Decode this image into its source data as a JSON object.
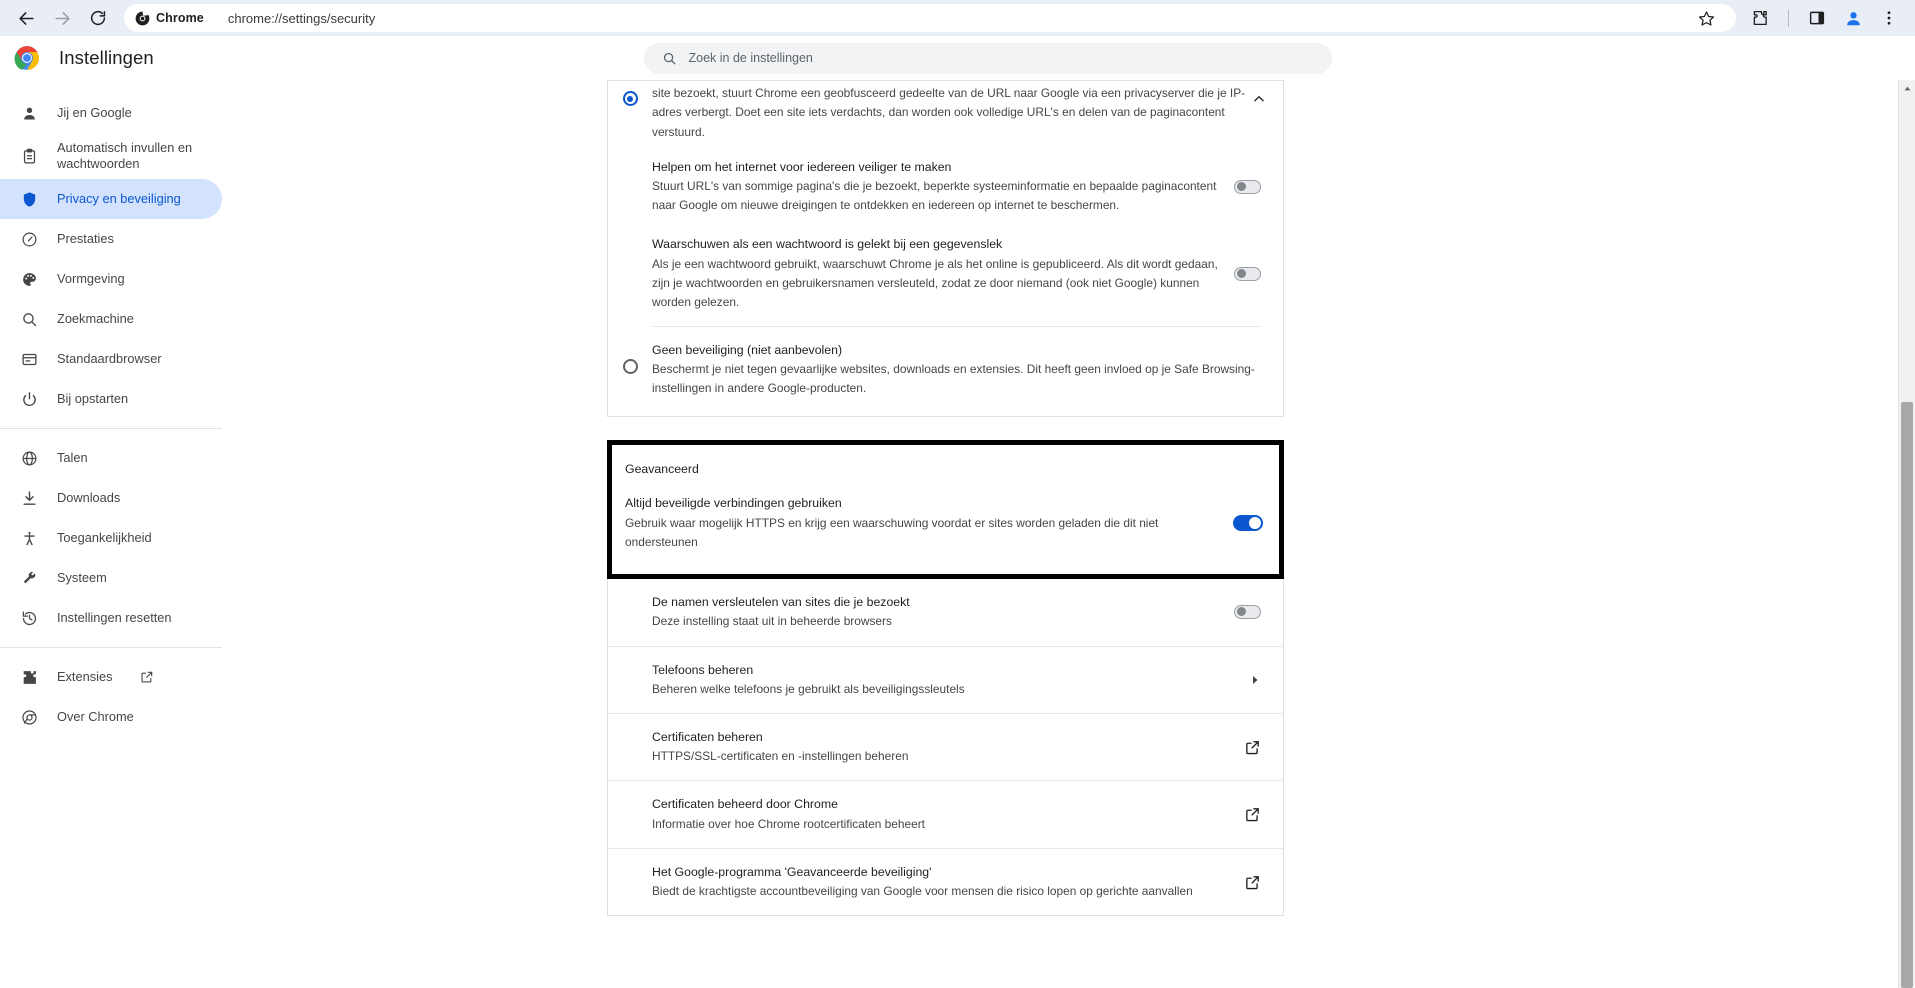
{
  "browser": {
    "back_label": "back-arrow",
    "forward_label": "forward-arrow",
    "reload_label": "reload",
    "chrome_chip_label": "Chrome",
    "url": "chrome://settings/security",
    "bookmark_label": "bookmark-star",
    "extensions_label": "extensions-puzzle",
    "sidepanel_label": "side-panel",
    "profile_label": "profile-avatar",
    "menu_label": "three-dot-menu"
  },
  "header": {
    "title": "Instellingen",
    "logo": "chrome-logo"
  },
  "search": {
    "placeholder": "Zoek in de instellingen",
    "icon": "search-icon"
  },
  "sidebar": {
    "items": [
      {
        "label": "Jij en Google",
        "icon": "person-icon",
        "active": false
      },
      {
        "label": "Automatisch invullen en wachtwoorden",
        "icon": "clipboard-icon",
        "active": false
      },
      {
        "label": "Privacy en beveiliging",
        "icon": "shield-icon",
        "active": true
      },
      {
        "label": "Prestaties",
        "icon": "speedometer-icon",
        "active": false
      },
      {
        "label": "Vormgeving",
        "icon": "palette-icon",
        "active": false
      },
      {
        "label": "Zoekmachine",
        "icon": "search-icon",
        "active": false
      },
      {
        "label": "Standaardbrowser",
        "icon": "browser-window-icon",
        "active": false
      },
      {
        "label": "Bij opstarten",
        "icon": "power-icon",
        "active": false
      }
    ],
    "items2": [
      {
        "label": "Talen",
        "icon": "globe-icon"
      },
      {
        "label": "Downloads",
        "icon": "download-icon"
      },
      {
        "label": "Toegankelijkheid",
        "icon": "accessibility-icon"
      },
      {
        "label": "Systeem",
        "icon": "wrench-icon"
      },
      {
        "label": "Instellingen resetten",
        "icon": "history-restore-icon"
      }
    ],
    "items3": [
      {
        "label": "Extensies",
        "icon": "puzzle-icon",
        "external": true
      },
      {
        "label": "Over Chrome",
        "icon": "chrome-icon",
        "external": false
      }
    ]
  },
  "main": {
    "enhanced_protection": {
      "description": "site bezoekt, stuurt Chrome een geobfusceerd gedeelte van de URL naar Google via een privacyserver die je IP-adres verbergt. Doet een site iets verdachts, dan worden ook volledige URL's en delen van de paginacontent verstuurd.",
      "selected": true
    },
    "sub_settings": [
      {
        "title": "Helpen om het internet voor iedereen veiliger te maken",
        "sub": "Stuurt URL's van sommige pagina's die je bezoekt, beperkte systeeminformatie en bepaalde paginacontent naar Google om nieuwe dreigingen te ontdekken en iedereen op internet te beschermen.",
        "toggle_on": false
      },
      {
        "title": "Waarschuwen als een wachtwoord is gelekt bij een gegevenslek",
        "sub": "Als je een wachtwoord gebruikt, waarschuwt Chrome je als het online is gepubliceerd. Als dit wordt gedaan, zijn je wachtwoorden en gebruikersnamen versleuteld, zodat ze door niemand (ook niet Google) kunnen worden gelezen.",
        "toggle_on": false
      }
    ],
    "no_protection": {
      "title": "Geen beveiliging (niet aanbevolen)",
      "sub": "Beschermt je niet tegen gevaarlijke websites, downloads en extensies. Dit heeft geen invloed op je Safe Browsing-instellingen in andere Google-producten.",
      "selected": false
    },
    "advanced": {
      "section_label": "Geavanceerd",
      "https_title": "Altijd beveiligde verbindingen gebruiken",
      "https_sub": "Gebruik waar mogelijk HTTPS en krijg een waarschuwing voordat er sites worden geladen die dit niet ondersteunen",
      "https_toggle_on": true,
      "highlight_color": "#000000"
    },
    "rows": [
      {
        "title": "De namen versleutelen van sites die je bezoekt",
        "sub": "Deze instelling staat uit in beheerde browsers",
        "control": "toggle",
        "toggle_on": false
      },
      {
        "title": "Telefoons beheren",
        "sub": "Beheren welke telefoons je gebruikt als beveiligingssleutels",
        "control": "chevron"
      },
      {
        "title": "Certificaten beheren",
        "sub": "HTTPS/SSL-certificaten en -instellingen beheren",
        "control": "external"
      },
      {
        "title": "Certificaten beheerd door Chrome",
        "sub": "Informatie over hoe Chrome rootcertificaten beheert",
        "control": "external"
      },
      {
        "title": "Het Google-programma 'Geavanceerde beveiliging'",
        "sub": "Biedt de krachtigste accountbeveiliging van Google voor mensen die risico lopen op gerichte aanvallen",
        "control": "external"
      }
    ],
    "collapse_icon": "chevron-up-icon"
  },
  "colors": {
    "accent": "#0b57d0",
    "active_bg": "#d3e3fd",
    "toolbar_bg": "#e9edf6"
  }
}
